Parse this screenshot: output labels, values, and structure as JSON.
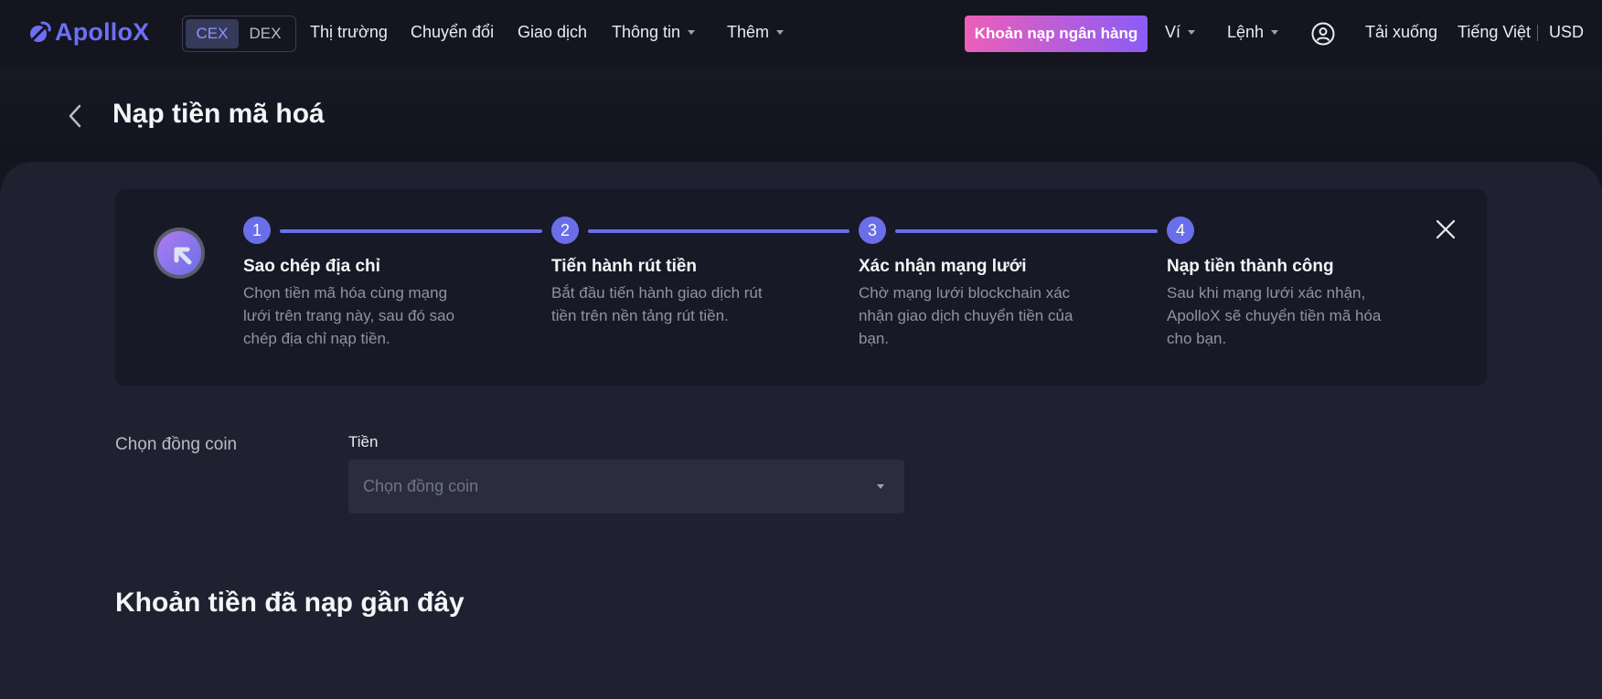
{
  "nav": {
    "logo_text": "ApolloX",
    "mode_cex": "CEX",
    "mode_dex": "DEX",
    "market": "Thị trường",
    "convert": "Chuyển đổi",
    "trade": "Giao dịch",
    "info": "Thông tin",
    "more": "Thêm",
    "bank_deposit": "Khoản nạp ngân hàng",
    "wallet": "Ví",
    "orders": "Lệnh",
    "download": "Tải xuống",
    "language": "Tiếng Việt",
    "currency": "USD"
  },
  "page": {
    "title": "Nạp tiền mã hoá"
  },
  "guide": {
    "steps": [
      {
        "num": "1",
        "title": "Sao chép địa chỉ",
        "desc": "Chọn tiền mã hóa cùng mạng lưới trên trang này, sau đó sao chép địa chỉ nạp tiền."
      },
      {
        "num": "2",
        "title": "Tiến hành rút tiền",
        "desc": "Bắt đầu tiến hành giao dịch rút tiền trên nền tảng rút tiền."
      },
      {
        "num": "3",
        "title": "Xác nhận mạng lưới",
        "desc": "Chờ mạng lưới blockchain xác nhận giao dịch chuyển tiền của bạn."
      },
      {
        "num": "4",
        "title": "Nạp tiền thành công",
        "desc": "Sau khi mạng lưới xác nhận, ApolloX sẽ chuyển tiền mã hóa cho bạn."
      }
    ]
  },
  "form": {
    "section_label": "Chọn đồng coin",
    "field_label": "Tiền",
    "placeholder": "Chọn đồng coin"
  },
  "recent": {
    "title": "Khoản tiền đã nạp gần đây"
  },
  "colors": {
    "accent": "#6a6ee8",
    "brand": "#6c6ff5",
    "deposit_gradient_start": "#ec5fb8",
    "deposit_gradient_end": "#8b5cf6",
    "background": "#1f2030"
  }
}
